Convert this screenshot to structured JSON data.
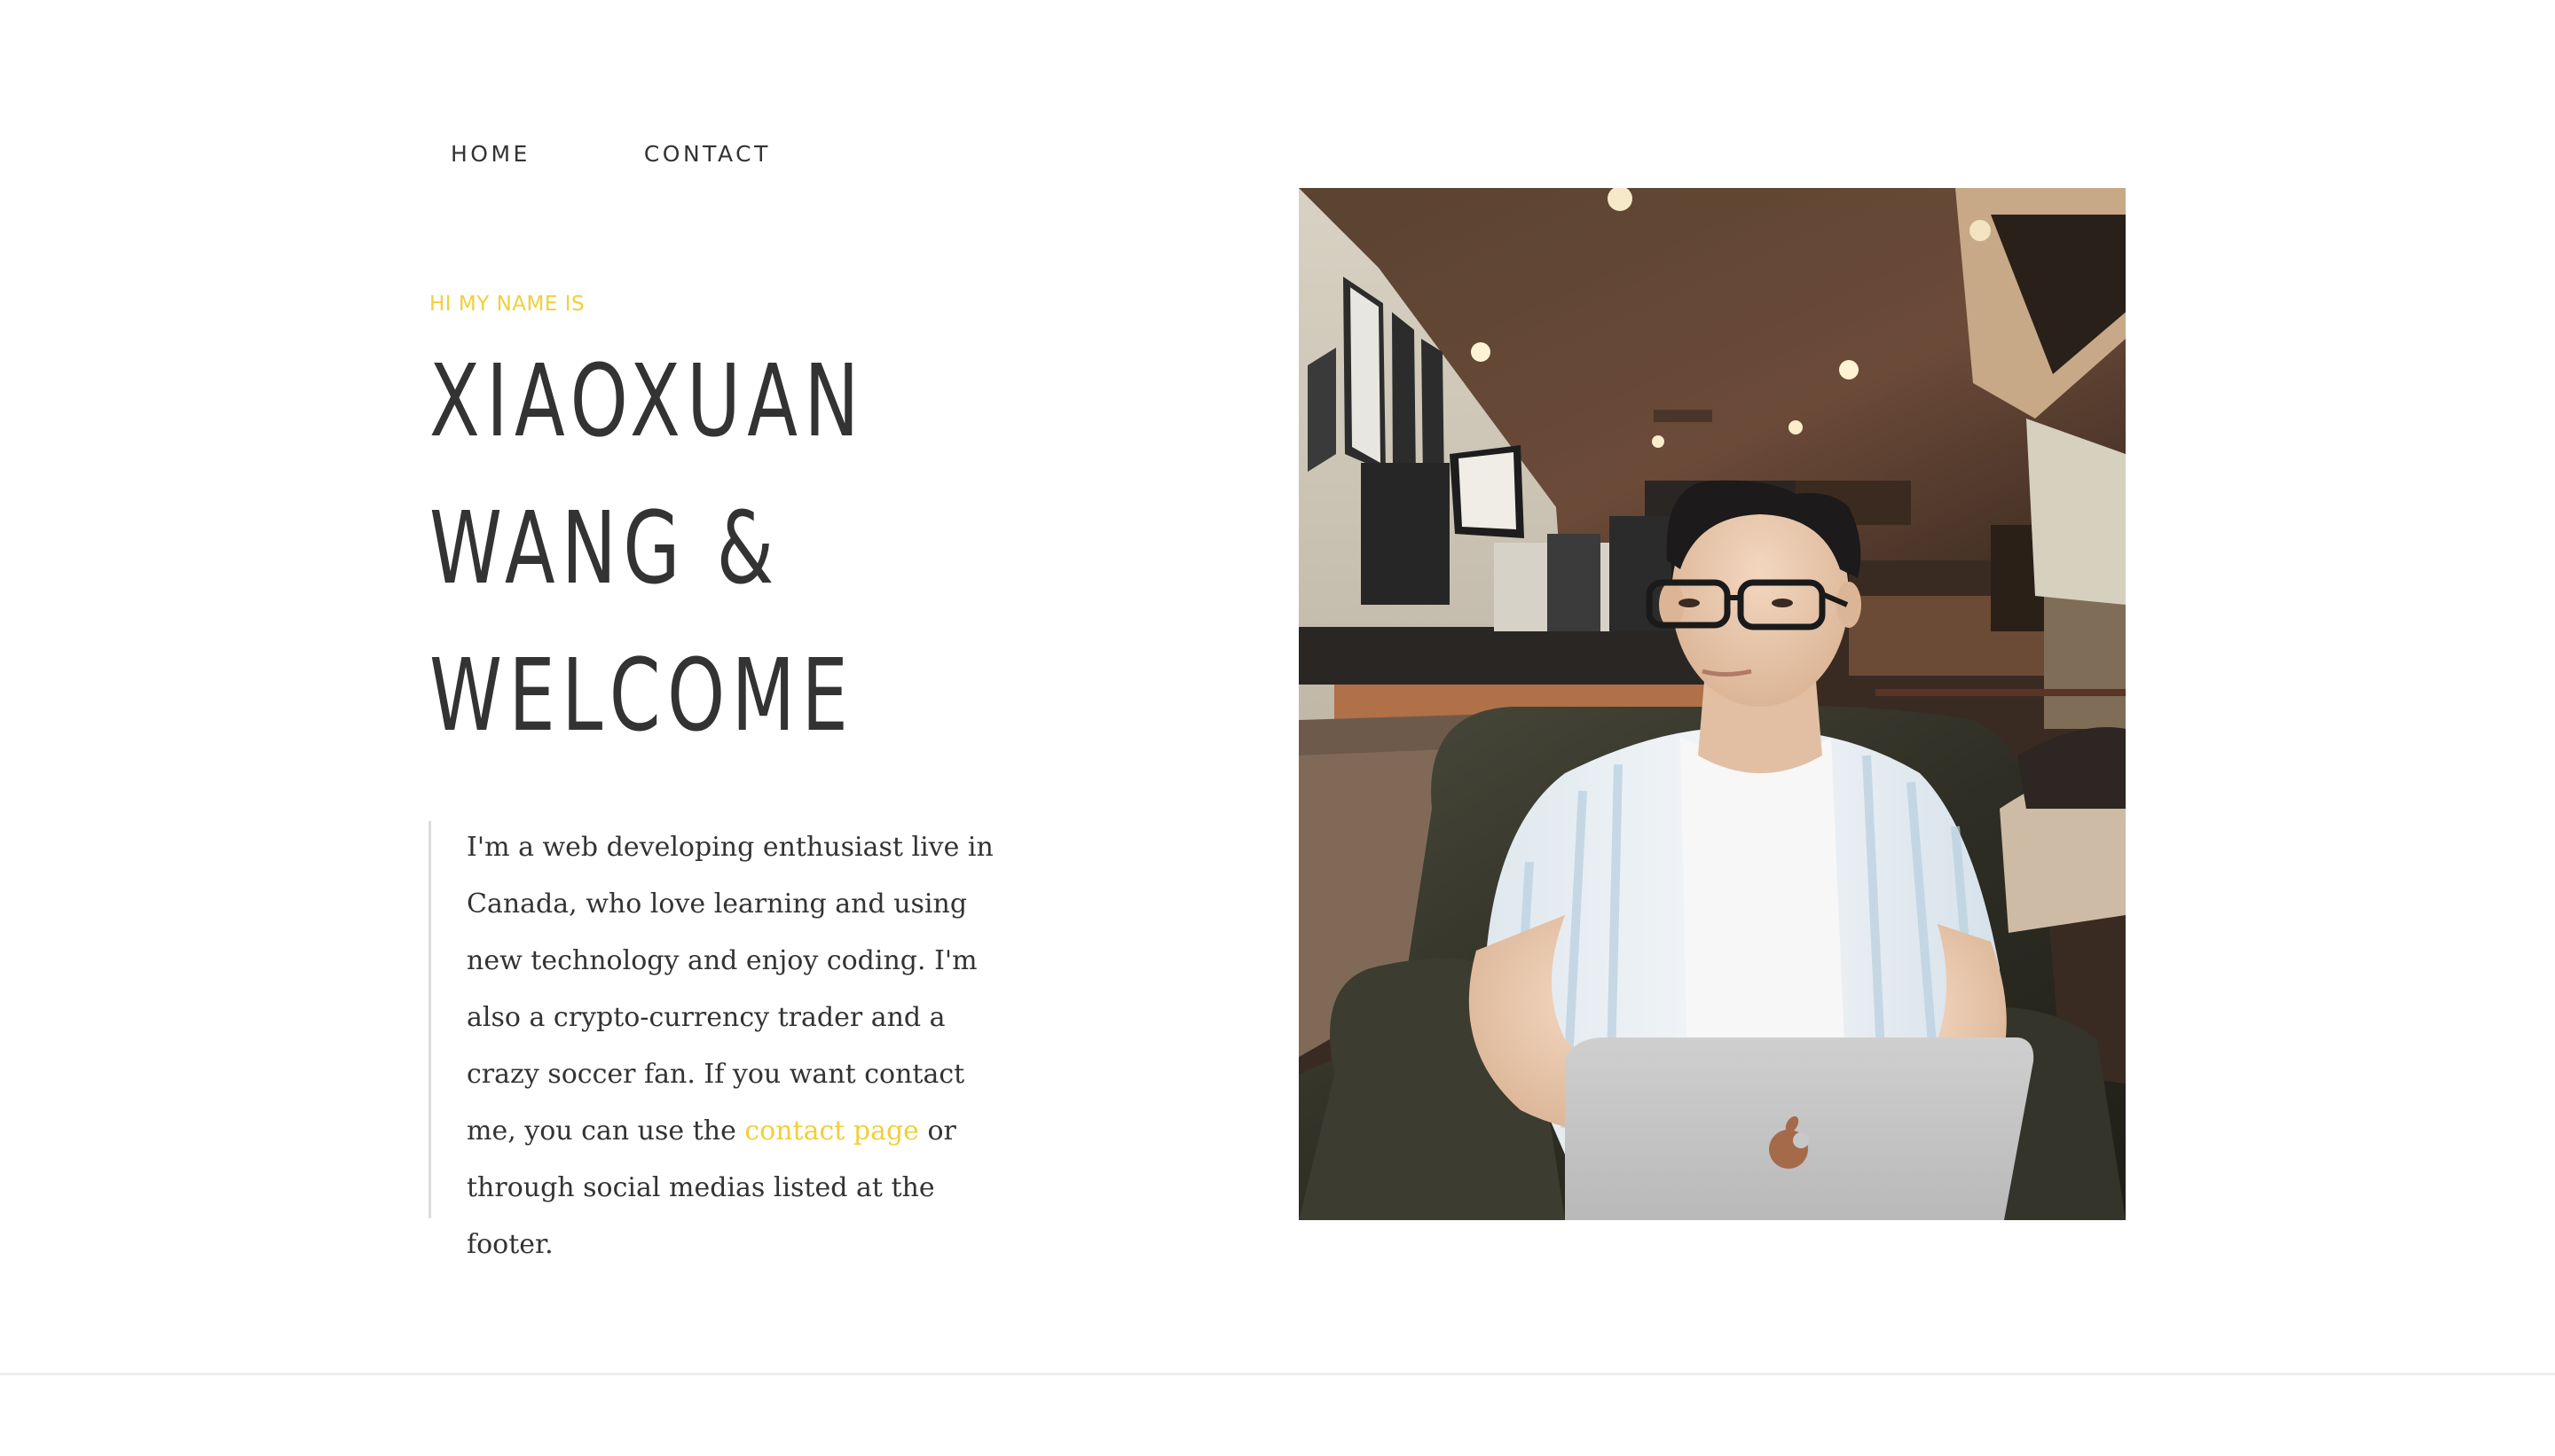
{
  "nav": {
    "items": [
      {
        "label": "HOME"
      },
      {
        "label": "CONTACT"
      }
    ]
  },
  "hero": {
    "eyebrow": "HI MY NAME IS",
    "title_lines": [
      "XIAOXUAN",
      "WANG &",
      "WELCOME"
    ]
  },
  "intro": {
    "text_before_link": "I'm a web developing enthusiast live in Canada, who love learning and using new technology and enjoy coding. I'm also a crypto-currency trader and a crazy soccer fan. If you want contact me, you can use the ",
    "link_label": "contact page",
    "text_after_link": " or through social medias listed at the footer."
  },
  "photo": {
    "icon": "portrait-photo"
  },
  "colors": {
    "accent": "#f2cf38",
    "text": "#333333",
    "divider": "#eeeeee",
    "background": "#ffffff"
  }
}
